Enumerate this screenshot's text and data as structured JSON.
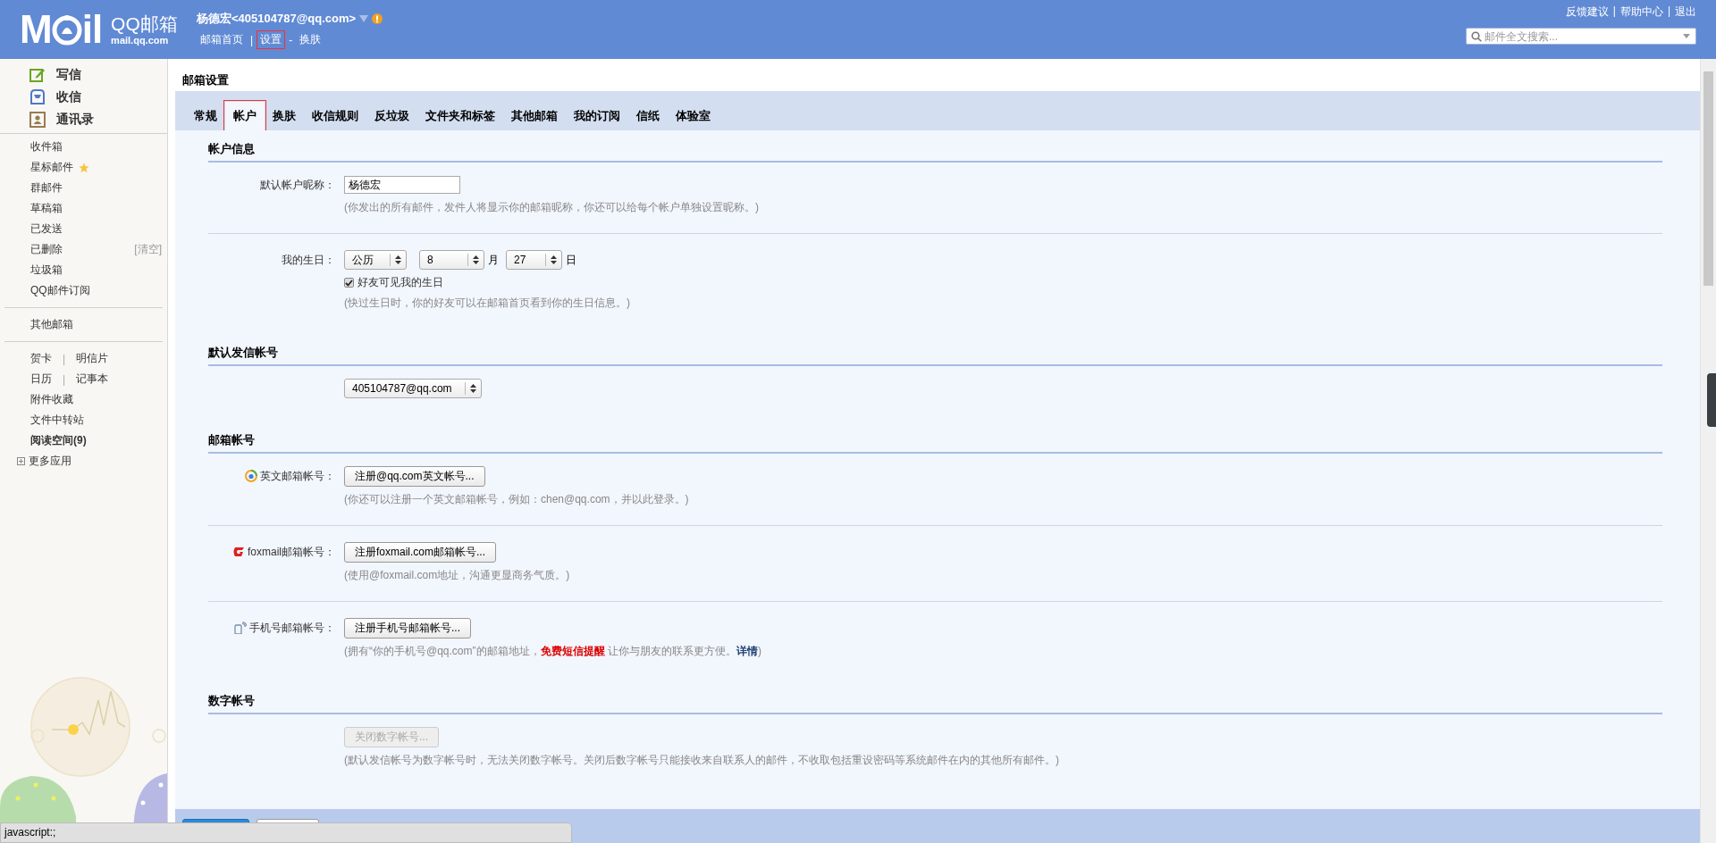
{
  "header": {
    "logo": {
      "letters_left": "M",
      "letters_right": "il",
      "name": "QQ邮箱",
      "domain": "mail.qq.com"
    },
    "user": "杨德宏<405104787@qq.com>",
    "nav_links": [
      {
        "label": "邮箱首页",
        "highlighted": false
      },
      {
        "label": "设置",
        "separator": "|",
        "highlighted": true
      },
      {
        "label": "换肤",
        "separator": "-",
        "highlighted": false
      }
    ],
    "top_links": [
      {
        "label": "反馈建议"
      },
      {
        "label": "帮助中心",
        "separator": "|"
      },
      {
        "label": "退出",
        "separator": "|"
      }
    ],
    "search": {
      "placeholder": "邮件全文搜索..."
    }
  },
  "sidebar": {
    "actions": [
      {
        "label": "写信",
        "kind": "compose"
      },
      {
        "label": "收信",
        "kind": "inbox"
      },
      {
        "label": "通讯录",
        "kind": "contacts"
      }
    ],
    "groups": [
      {
        "items": [
          {
            "label": "收件箱",
            "kind": "folder"
          },
          {
            "label": "星标邮件",
            "kind": "starred"
          },
          {
            "label": "群邮件",
            "kind": "folder"
          },
          {
            "label": "草稿箱",
            "kind": "folder"
          },
          {
            "label": "已发送",
            "kind": "folder"
          },
          {
            "label": "已删除",
            "kind": "clearable",
            "action": "[清空]"
          },
          {
            "label": "垃圾箱",
            "kind": "folder"
          },
          {
            "label": "QQ邮件订阅",
            "kind": "folder"
          }
        ]
      },
      {
        "items": [
          {
            "label": "其他邮箱",
            "kind": "folder"
          }
        ]
      },
      {
        "items": [
          {
            "label": "贺卡",
            "kind": "pair",
            "separator": "|",
            "second_label": "明信片"
          },
          {
            "label": "日历",
            "kind": "pair",
            "separator": "|",
            "second_label": "记事本"
          },
          {
            "label": "附件收藏",
            "kind": "folder"
          },
          {
            "label": "文件中转站",
            "kind": "folder"
          },
          {
            "label": "阅读空间(9)",
            "kind": "unread"
          },
          {
            "label": "更多应用",
            "kind": "more"
          }
        ]
      }
    ]
  },
  "content": {
    "title": "邮箱设置",
    "tabs": [
      {
        "label": "常规",
        "selected": false,
        "highlighted": false
      },
      {
        "label": "帐户",
        "selected": true,
        "highlighted": true
      },
      {
        "label": "换肤",
        "selected": false,
        "highlighted": false
      },
      {
        "label": "收信规则",
        "selected": false,
        "highlighted": false
      },
      {
        "label": "反垃圾",
        "selected": false,
        "highlighted": false
      },
      {
        "label": "文件夹和标签",
        "selected": false,
        "highlighted": false
      },
      {
        "label": "其他邮箱",
        "selected": false,
        "highlighted": false
      },
      {
        "label": "我的订阅",
        "selected": false,
        "highlighted": false
      },
      {
        "label": "信纸",
        "selected": false,
        "highlighted": false
      },
      {
        "label": "体验室",
        "selected": false,
        "highlighted": false
      }
    ],
    "sections": [
      {
        "title": "帐户信息",
        "rows": [
          {
            "kind": "text_field",
            "label": "默认帐户昵称：",
            "value": "杨德宏",
            "hint": "(你发出的所有邮件，发件人将显示你的邮箱昵称，你还可以给每个帐户单独设置昵称。)"
          },
          {
            "kind": "birthday",
            "label": "我的生日：",
            "selects": [
              {
                "value": "公历"
              },
              {
                "value": "8",
                "unit": "月"
              },
              {
                "value": "27",
                "unit": "日"
              }
            ],
            "checkbox": {
              "label": "好友可见我的生日",
              "checked": true
            },
            "hint": "(快过生日时，你的好友可以在邮箱首页看到你的生日信息。)"
          }
        ]
      },
      {
        "title": "默认发信帐号",
        "rows": [
          {
            "kind": "select",
            "value": "405104787@qq.com"
          }
        ]
      },
      {
        "title": "邮箱帐号",
        "rows": [
          {
            "kind": "button",
            "label": "英文邮箱帐号：",
            "button": {
              "label": "注册@qq.com英文帐号...",
              "disabled": false
            },
            "hint": "(你还可以注册一个英文邮箱帐号，例如：chen@qq.com，并以此登录。)"
          },
          {
            "kind": "button",
            "label": "foxmail邮箱帐号：",
            "button": {
              "label": "注册foxmail.com邮箱帐号...",
              "disabled": false
            },
            "hint": "(使用@foxmail.com地址，沟通更显商务气质。)"
          },
          {
            "kind": "button",
            "label": "手机号邮箱帐号：",
            "button": {
              "label": "注册手机号邮箱帐号...",
              "disabled": false
            },
            "hint": [
              {
                "kind": "plain",
                "text": "(拥有“你的手机号@qq.com”的邮箱地址，"
              },
              {
                "kind": "alert",
                "text": "免费短信提醒"
              },
              {
                "kind": "plain",
                "text": " 让你与朋友的联系更方便。"
              },
              {
                "kind": "link",
                "text": "详情"
              },
              {
                "kind": "plain",
                "text": ")"
              }
            ]
          }
        ]
      },
      {
        "title": "数字帐号",
        "rows": [
          {
            "kind": "button",
            "button": {
              "label": "关闭数字帐号...",
              "disabled": true
            },
            "hint": "(默认发信帐号为数字帐号时，无法关闭数字帐号。关闭后数字帐号只能接收来自联系人的邮件，不收取包括重设密码等系统邮件在内的其他所有邮件。)"
          }
        ]
      }
    ],
    "footer": {
      "buttons": [
        {
          "kind": "primary"
        },
        {
          "kind": "default"
        }
      ]
    }
  },
  "status_bar": {
    "text": "javascript:;"
  }
}
